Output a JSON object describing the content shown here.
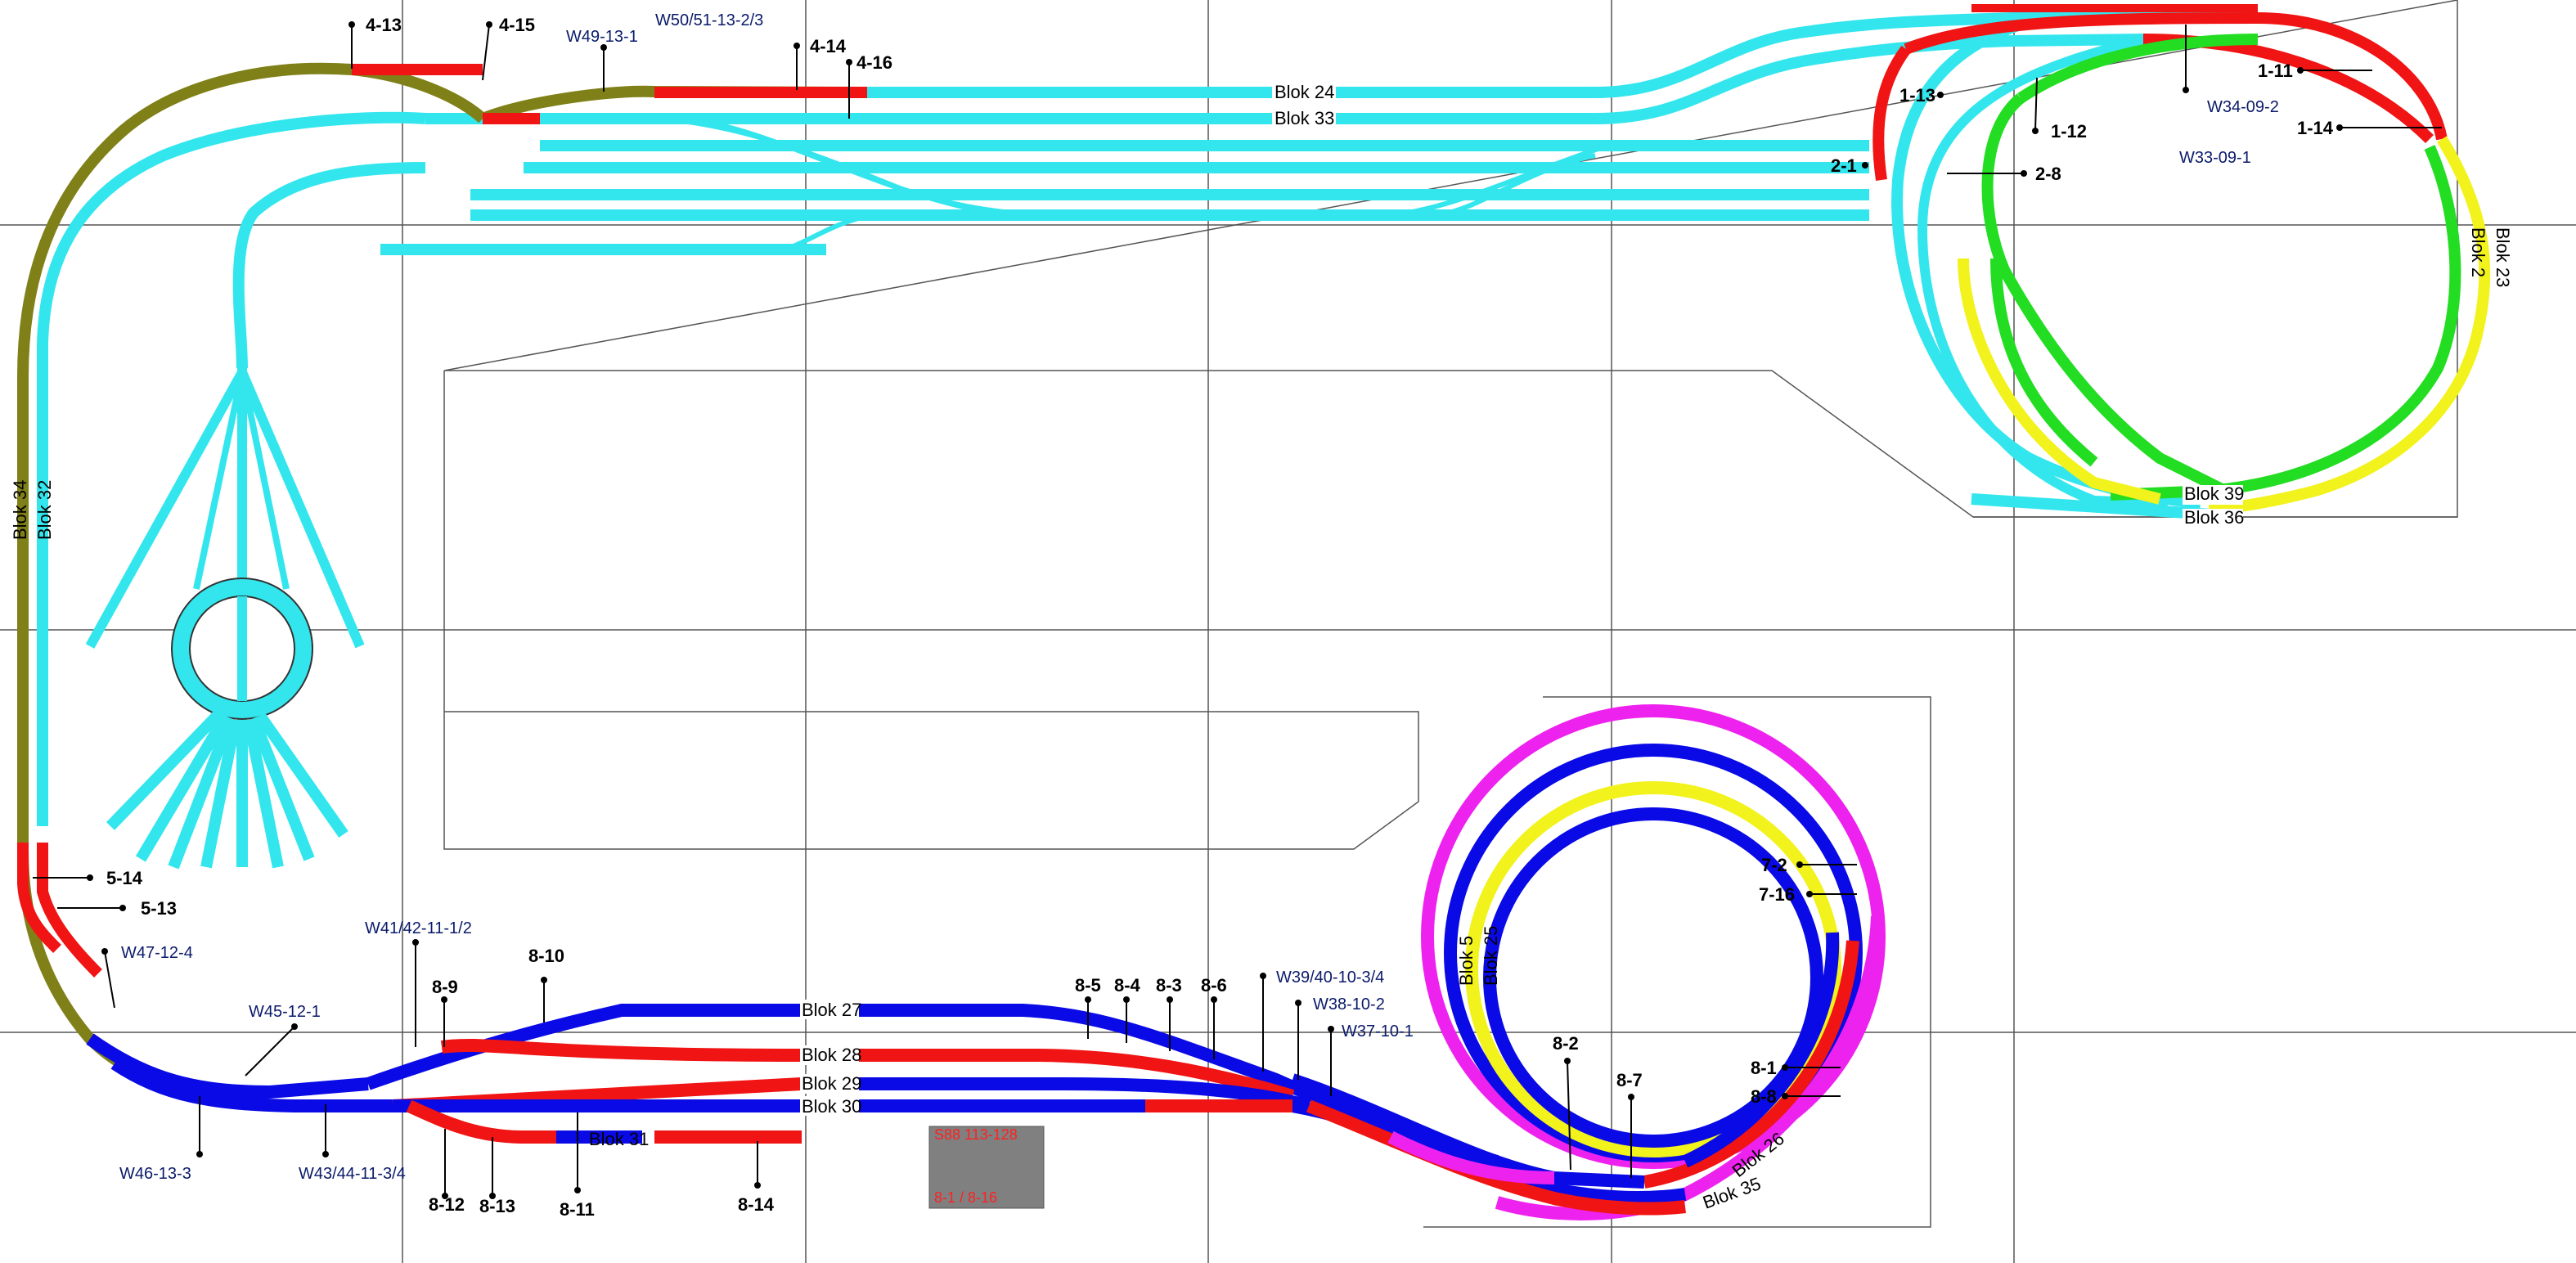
{
  "colors": {
    "cyan": "#33e6ee",
    "red": "#f01414",
    "olive": "#808018",
    "green": "#22dd22",
    "yellow": "#f2f21c",
    "blue": "#0a0ae6",
    "magenta": "#ee22ee",
    "grid": "#555555",
    "box": "#808080"
  },
  "blocks": {
    "b24": "Blok 24",
    "b33": "Blok 33",
    "b34": "Blok 34",
    "b32": "Blok 32",
    "b2": "Blok 2",
    "b23": "Blok 23",
    "b39": "Blok 39",
    "b36": "Blok 36",
    "b5": "Blok 5",
    "b25": "Blok 25",
    "b26": "Blok 26",
    "b35": "Blok 35",
    "b27": "Blok 27",
    "b28": "Blok 28",
    "b29": "Blok 29",
    "b30": "Blok 30",
    "b31": "Blok 31"
  },
  "sensors": {
    "s4_13": "4-13",
    "s4_15": "4-15",
    "s4_14": "4-14",
    "s4_16": "4-16",
    "s1_13": "1-13",
    "s1_12": "1-12",
    "s1_11": "1-11",
    "s1_14": "1-14",
    "s2_1": "2-1",
    "s2_8": "2-8",
    "s5_14": "5-14",
    "s5_13": "5-13",
    "s8_10": "8-10",
    "s8_9": "8-9",
    "s8_5": "8-5",
    "s8_4": "8-4",
    "s8_3": "8-3",
    "s8_6": "8-6",
    "s8_12": "8-12",
    "s8_13": "8-13",
    "s8_11": "8-11",
    "s8_14": "8-14",
    "s8_2": "8-2",
    "s8_7": "8-7",
    "s8_1": "8-1",
    "s8_8": "8-8",
    "s7_2": "7-2",
    "s7_16": "7-16"
  },
  "switches": {
    "w49": "W49-13-1",
    "w50": "W50/51-13-2/3",
    "w34": "W34-09-2",
    "w33": "W33-09-1",
    "w47": "W47-12-4",
    "w41": "W41/42-11-1/2",
    "w45": "W45-12-1",
    "w46": "W46-13-3",
    "w43": "W43/44-11-3/4",
    "w39": "W39/40-10-3/4",
    "w38": "W38-10-2",
    "w37": "W37-10-1"
  },
  "module_box": {
    "line1": "S88 113-128",
    "line2": "8-1 / 8-16"
  }
}
